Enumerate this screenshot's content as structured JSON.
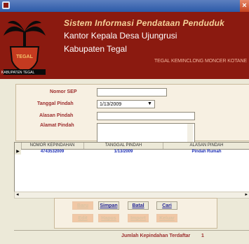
{
  "app": {
    "title_line1": "Sistem Informasi Pendataan Penduduk",
    "title_line2": "Kantor Kepala Desa Ujungrusi",
    "title_line3": "Kabupaten Tegal",
    "tagline": "TEGAL KEMINCLONG MONCER KOTANE",
    "logo_caption": "KABUPATEN TEGAL"
  },
  "form": {
    "nomor_sep_label": "Nomor SEP",
    "nomor_sep_value": "",
    "tanggal_pindah_label": "Tanggal Pindah",
    "tanggal_pindah_value": "1/13/2009",
    "alasan_pindah_label": "Alasan Pindah",
    "alasan_pindah_value": "",
    "alamat_pindah_label": "Alamat Pindah",
    "alamat_pindah_value": ""
  },
  "grid": {
    "columns": [
      "NOMOR KEPINDAHAN",
      "TANGGAL PINDAH",
      "ALASAN PINDAH"
    ],
    "rows": [
      [
        "4743532009",
        "1/13/2009",
        "Pindah Rumah"
      ]
    ],
    "row_marker": "▶"
  },
  "buttons": {
    "baru": "Baru",
    "simpan": "Simpan",
    "batal": "Batal",
    "cari": "Cari",
    "edit": "Edit",
    "hapus": "Hapus",
    "import": "Import",
    "keluar": "Keluar"
  },
  "status": {
    "label": "Jumlah Kepindahan Terdaftar",
    "count": "1"
  },
  "colors": {
    "banner": "#8b1a10",
    "label": "#9d2e2e",
    "row_text": "#1a2cb4",
    "enabled_button_text": "#1d1d8f"
  }
}
